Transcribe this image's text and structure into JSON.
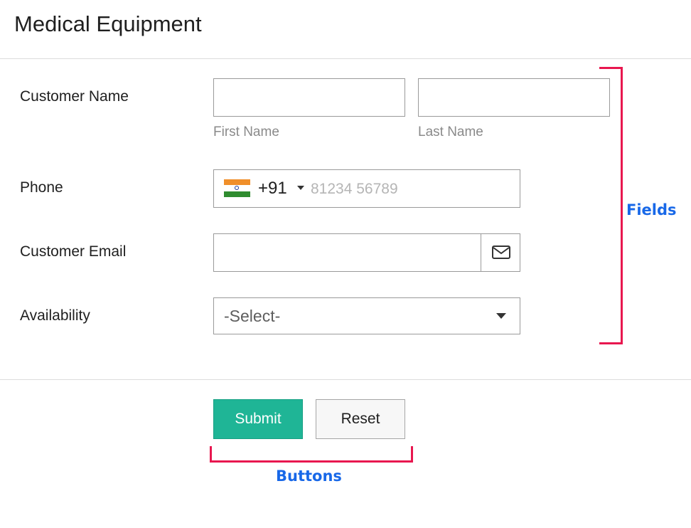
{
  "form": {
    "title": "Medical Equipment",
    "customer_name": {
      "label": "Customer Name",
      "first_name": {
        "value": "",
        "sublabel": "First Name"
      },
      "last_name": {
        "value": "",
        "sublabel": "Last Name"
      }
    },
    "phone": {
      "label": "Phone",
      "country_flag": "india-flag-icon",
      "country_code": "+91",
      "placeholder": "81234 56789",
      "value": ""
    },
    "customer_email": {
      "label": "Customer Email",
      "value": "",
      "icon": "envelope-icon"
    },
    "availability": {
      "label": "Availability",
      "selected": "-Select-"
    }
  },
  "buttons": {
    "submit_label": "Submit",
    "reset_label": "Reset"
  },
  "annotations": {
    "fields_label": "Fields",
    "buttons_label": "Buttons",
    "bracket_color": "#e8174f",
    "text_color": "#1868e8"
  },
  "colors": {
    "submit_bg": "#1fb596",
    "reset_bg": "#f7f7f7"
  }
}
